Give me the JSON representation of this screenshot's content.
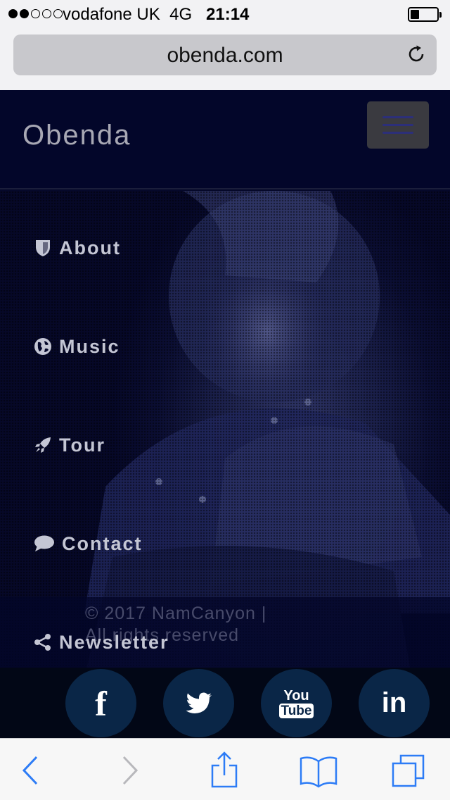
{
  "status_bar": {
    "carrier": "vodafone UK",
    "network": "4G",
    "time": "21:14",
    "signal_strength": 2,
    "battery_level": 0.25
  },
  "browser": {
    "url": "obenda.com",
    "accent_color": "#2d7cf6"
  },
  "site": {
    "brand": "Obenda",
    "menu_toggle_icon": "hamburger-icon",
    "nav": [
      {
        "label": "About",
        "icon": "shield-icon"
      },
      {
        "label": "Music",
        "icon": "globe-icon"
      },
      {
        "label": "Tour",
        "icon": "rocket-icon"
      },
      {
        "label": "Contact",
        "icon": "speech-bubble-icon"
      },
      {
        "label": "Newsletter",
        "icon": "share-icon"
      }
    ],
    "copyright_line1": "© 2017 NamCanyon |",
    "copyright_line2": "All rights reserved",
    "social": [
      {
        "label": "f",
        "icon": "facebook-icon"
      },
      {
        "label": "",
        "icon": "twitter-icon"
      },
      {
        "label_top": "You",
        "label_bottom": "Tube",
        "icon": "youtube-icon"
      },
      {
        "label": "in",
        "icon": "linkedin-icon"
      }
    ],
    "colors": {
      "header_bg": "#03062a",
      "social_button_bg": "#0a2647",
      "nav_text": "#c4c6d4"
    }
  },
  "toolbar": {
    "items": [
      "back-icon",
      "forward-icon",
      "share-icon",
      "bookmarks-icon",
      "tabs-icon"
    ]
  }
}
